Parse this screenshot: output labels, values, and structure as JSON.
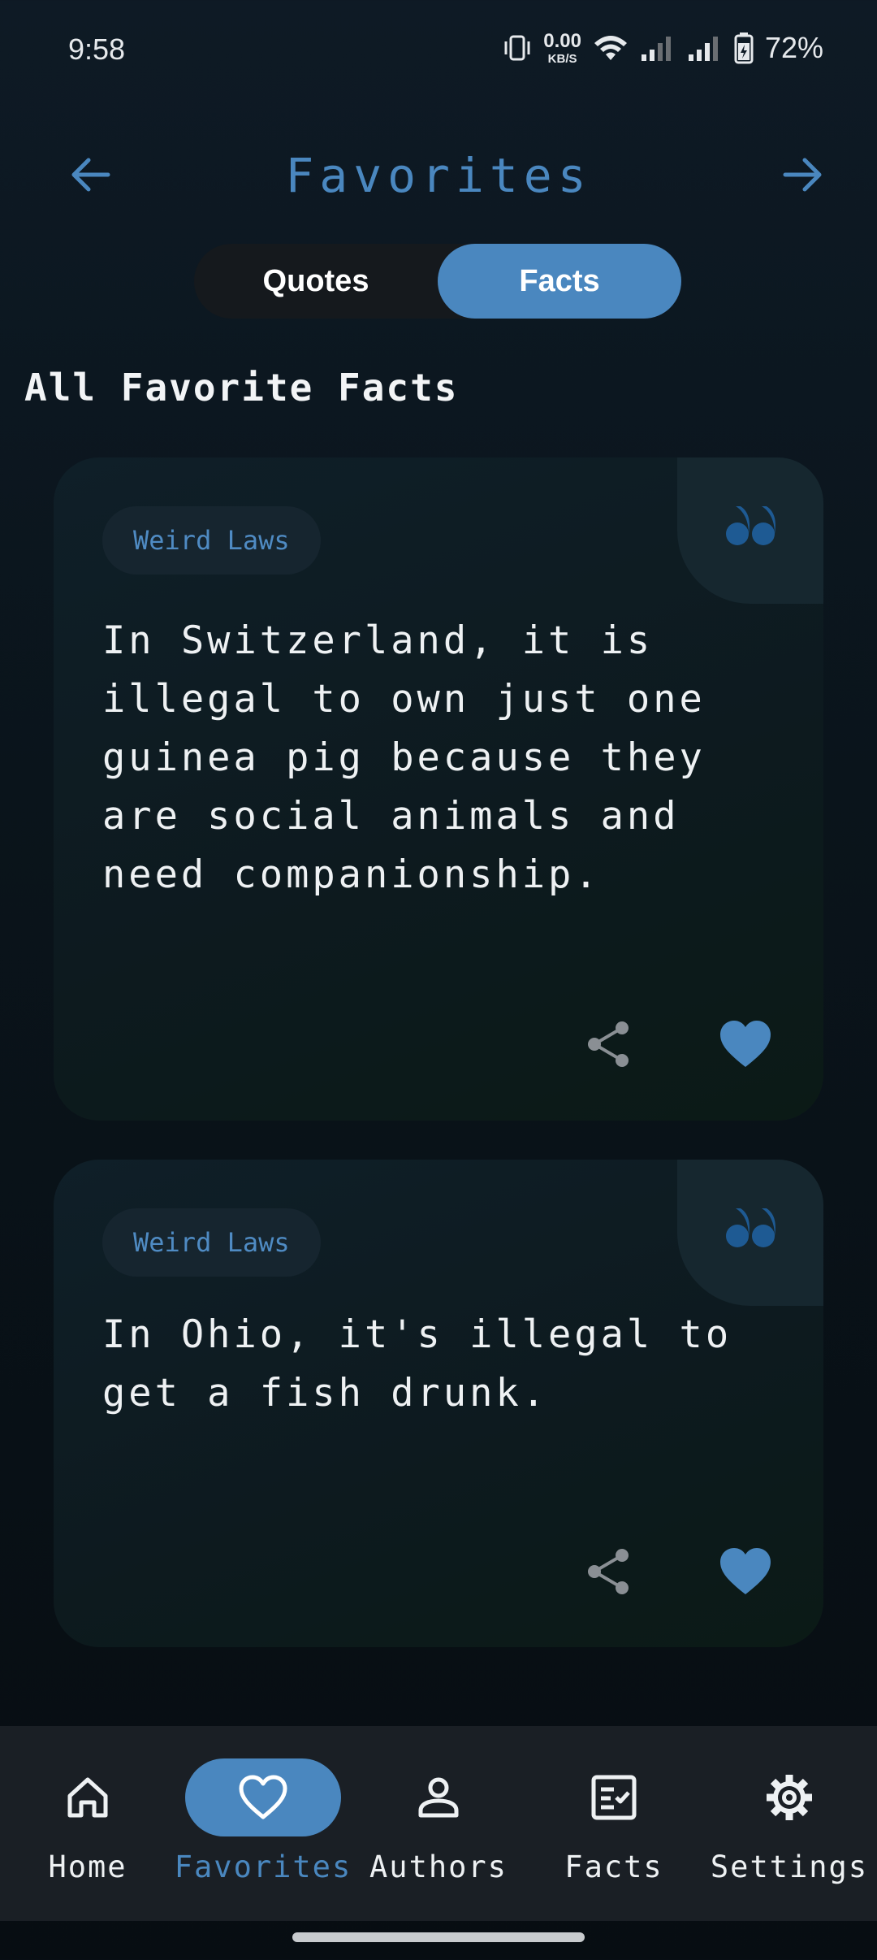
{
  "status_bar": {
    "time": "9:58",
    "net_speed_value": "0.00",
    "net_speed_unit": "KB/S",
    "battery": "72%",
    "icons": [
      "vibrate-icon",
      "wifi-icon",
      "signal-icon",
      "signal-icon",
      "battery-charging-icon"
    ]
  },
  "header": {
    "title": "Favorites",
    "back_icon": "arrow-left-icon",
    "forward_icon": "arrow-right-icon"
  },
  "segmented": {
    "options": [
      "Quotes",
      "Facts"
    ],
    "selected": "Facts"
  },
  "section_title": "All Favorite Facts",
  "cards": [
    {
      "category": "Weird Laws",
      "text": "In Switzerland, it is illegal to own just one guinea pig because they are social animals and need companionship.",
      "favorited": true
    },
    {
      "category": "Weird Laws",
      "text": "In Ohio, it's illegal to get a fish drunk.",
      "favorited": true
    }
  ],
  "bottom_nav": {
    "items": [
      {
        "label": "Home",
        "icon": "home-icon"
      },
      {
        "label": "Favorites",
        "icon": "heart-icon"
      },
      {
        "label": "Authors",
        "icon": "person-icon"
      },
      {
        "label": "Facts",
        "icon": "checklist-icon"
      },
      {
        "label": "Settings",
        "icon": "gear-icon"
      }
    ],
    "active": "Favorites"
  },
  "colors": {
    "accent": "#4a87bf",
    "background": "#0a141b",
    "card": "#0e1c22",
    "tag_text": "#4f8bc3",
    "nav_bar": "#1a1f25"
  }
}
